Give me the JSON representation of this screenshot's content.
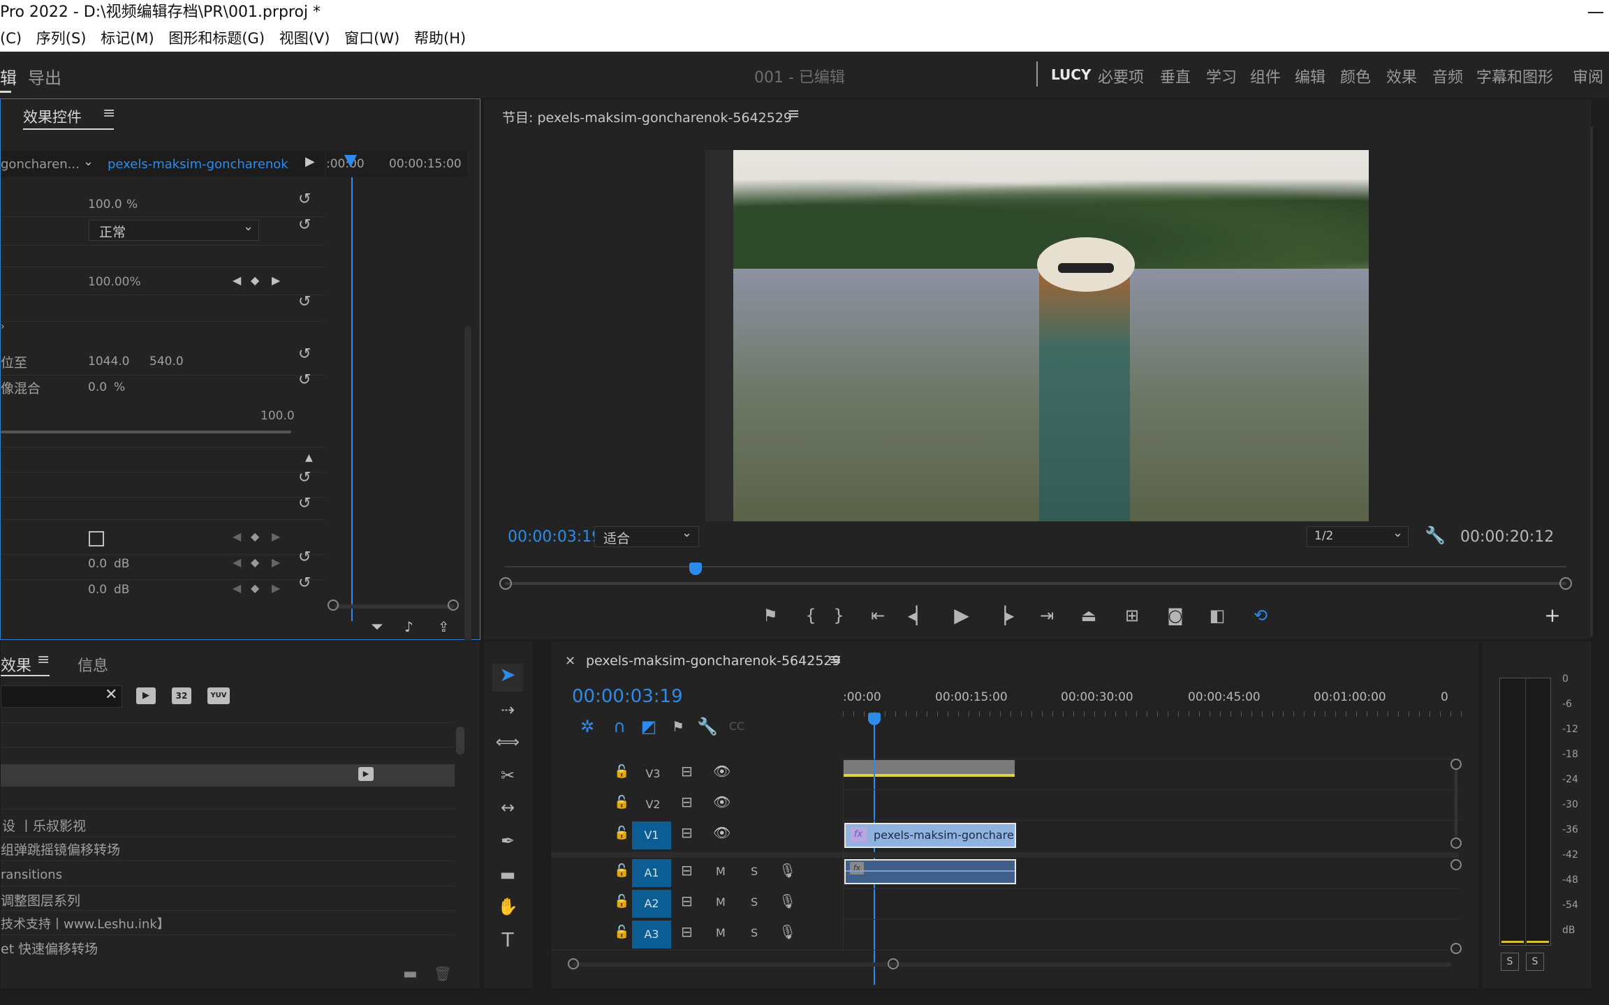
{
  "window": {
    "title": "Pro 2022 - D:\\视频编辑存档\\PR\\001.prproj *"
  },
  "menu": [
    "(C)",
    "序列(S)",
    "标记(M)",
    "图形和标题(G)",
    "视图(V)",
    "窗口(W)",
    "帮助(H)"
  ],
  "workspace": {
    "tabs": [
      "辑",
      "导出"
    ],
    "project_title": "001 - 已编辑",
    "presets": [
      "LUCY",
      "必要项",
      "垂直",
      "学习",
      "组件",
      "编辑",
      "颜色",
      "效果",
      "音频",
      "字幕和图形",
      "审阅"
    ]
  },
  "effect_controls": {
    "tab_label": "效果控件",
    "source_clip": "goncharen...",
    "seq_clip": "pexels-maksim-goncharenok",
    "ruler_start": ":00:00",
    "ruler_end": "00:00:15:00",
    "opacity_value": "100.0",
    "opacity_unit": "%",
    "blend_mode": "正常",
    "speed_value": "100.00%",
    "label_position": "位至",
    "pos_x": "1044.0",
    "pos_y": "540.0",
    "label_blend": "像混合",
    "blend_value": "0.0",
    "blend_unit": "%",
    "slider_max": "100.0",
    "volume_1": "0.0",
    "volume_2": "0.0",
    "db_unit": "dB"
  },
  "effects_panel": {
    "tab_effects": "效果",
    "tab_info": "信息",
    "badge_32": "32",
    "badge_yuv": "YUV",
    "items": [
      "设 丨乐叔影视",
      "组弹跳摇镜偏移转场",
      "ransitions",
      "调整图层系列",
      "技术支持丨www.Leshu.ink】",
      "et 快速偏移转场"
    ]
  },
  "program_monitor": {
    "title": "节目: pexels-maksim-goncharenok-5642529",
    "timecode": "00:00:03:19",
    "fit": "适合",
    "resolution": "1/2",
    "duration": "00:00:20:12"
  },
  "timeline": {
    "sequence_name": "pexels-maksim-goncharenok-5642529",
    "timecode": "00:00:03:19",
    "ruler": [
      ":00:00",
      "00:00:15:00",
      "00:00:30:00",
      "00:00:45:00",
      "00:01:00:00",
      "0"
    ],
    "video_tracks": [
      "V3",
      "V2",
      "V1"
    ],
    "audio_tracks": [
      "A1",
      "A2",
      "A3"
    ],
    "mute_label": "M",
    "solo_label": "S",
    "clip_label": "pexels-maksim-gonchare",
    "fx": "fx"
  },
  "meter": {
    "scale": [
      "0",
      "-6",
      "-12",
      "-18",
      "-24",
      "-30",
      "-36",
      "-42",
      "-48",
      "-54",
      "dB"
    ],
    "solo_left": "S",
    "solo_right": "S"
  },
  "colors": {
    "accent": "#2d8ceb",
    "track_active": "#0c5d94",
    "video_clip": "#8fb2e0",
    "audio_clip": "#3f5f8a"
  }
}
